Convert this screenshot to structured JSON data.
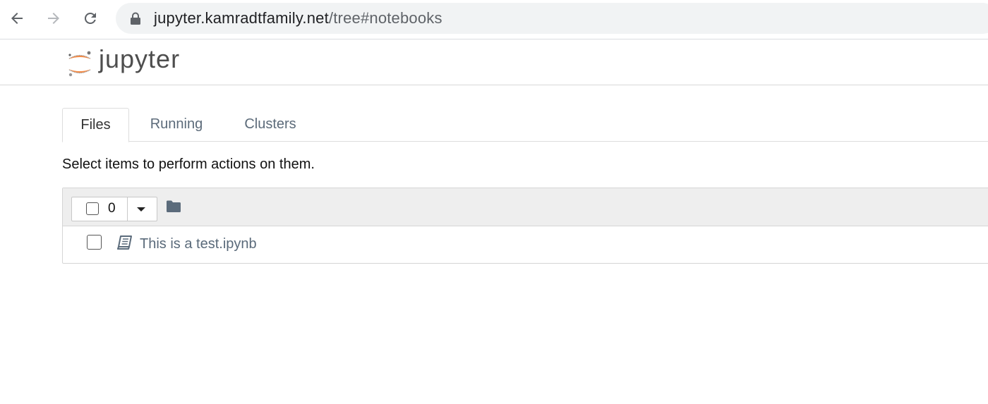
{
  "browser": {
    "url_host": "jupyter.kamradtfamily.net",
    "url_path": "/tree#notebooks"
  },
  "header": {
    "brand": "jupyter"
  },
  "tabs": [
    {
      "label": "Files",
      "active": true
    },
    {
      "label": "Running",
      "active": false
    },
    {
      "label": "Clusters",
      "active": false
    }
  ],
  "hint_text": "Select items to perform actions on them.",
  "toolbar": {
    "selected_count": "0"
  },
  "notebooks": [
    {
      "name": "This is a test.ipynb",
      "checked": false
    }
  ],
  "colors": {
    "link": "#5a6a7a",
    "toolbar_bg": "#eeeeee",
    "logo_orange": "#f37726"
  },
  "icons": {
    "back": "arrow-left-icon",
    "forward": "arrow-right-icon",
    "reload": "reload-icon",
    "lock": "lock-icon",
    "folder": "folder-icon",
    "notebook": "book-icon",
    "caret": "caret-down-icon"
  }
}
